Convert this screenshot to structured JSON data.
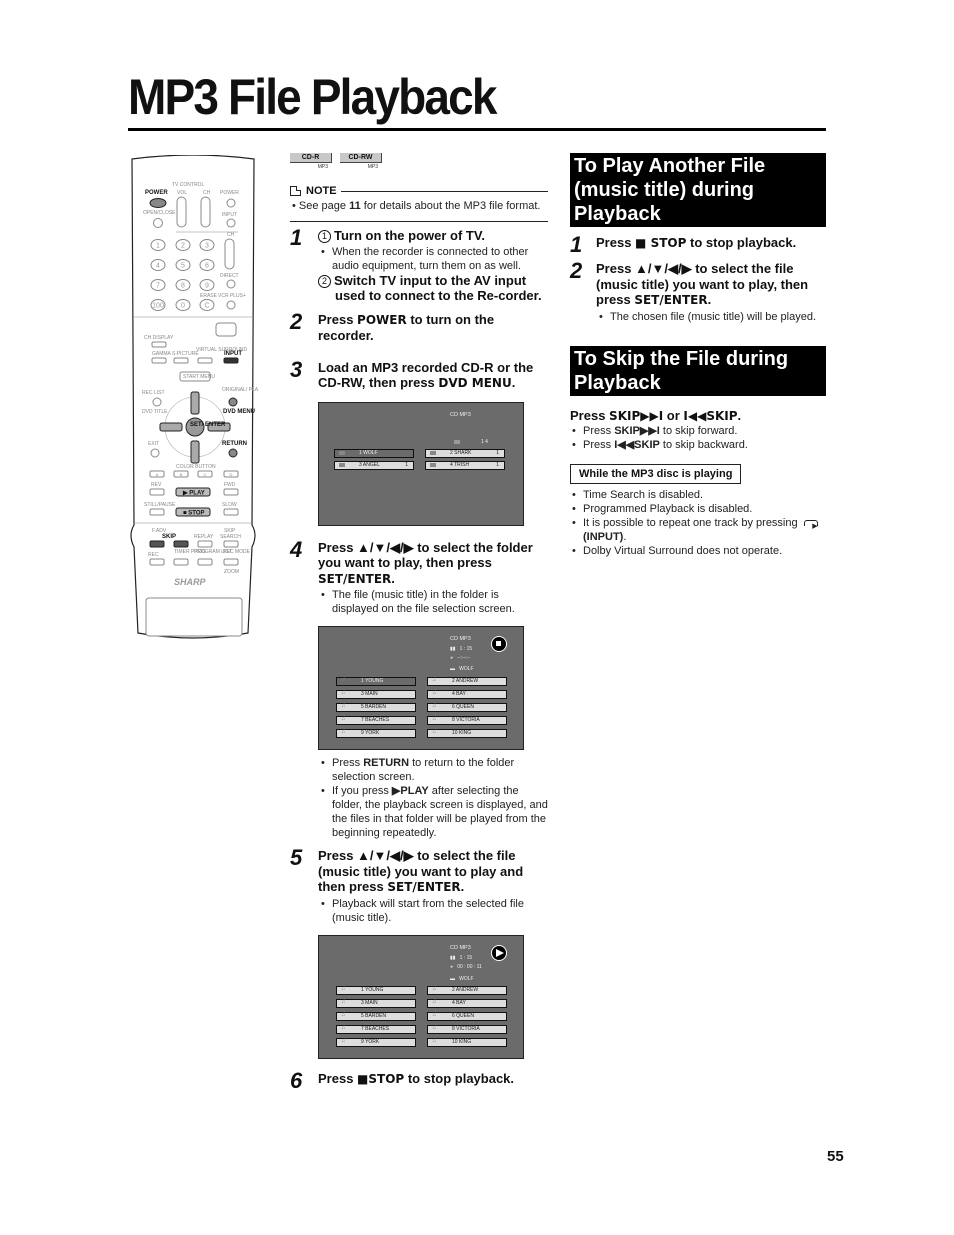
{
  "page": {
    "title": "MP3 File Playback",
    "page_number": "55"
  },
  "remote": {
    "brand": "SHARP",
    "labels": {
      "tv_control": "TV CONTROL",
      "power": "POWER",
      "vol": "VOL",
      "ch": "CH",
      "tv_power": "POWER",
      "open_close": "OPEN/CLOSE",
      "input": "INPUT",
      "ch2": "CH",
      "direct": "DIRECT",
      "erase": "ERASE",
      "vcr_plus": "VCR PLUS+",
      "ch_display": "CH DISPLAY",
      "gamma": "GAMMA",
      "s_picture": "S.PICTURE",
      "virtual_surround": "VIRTUAL SURROUND",
      "input2": "INPUT",
      "start_menu": "START MENU",
      "rec_list": "REC LIST",
      "original_play_list": "ORIGINAL/ PLAY LIST",
      "dvd_title": "DVD TITLE",
      "dvd_menu": "DVD MENU",
      "set_enter": "SET/ ENTER",
      "exit": "EXIT",
      "return": "RETURN",
      "color_button": "COLOR BUTTON",
      "rev": "REV",
      "fwd": "FWD",
      "play": "PLAY",
      "still_pause": "STILL/PAUSE",
      "slow": "SLOW",
      "stop": "STOP",
      "f_adv": "F.ADV",
      "skip": "SKIP",
      "replay": "REPLAY",
      "skip_search": "SKIP SEARCH",
      "rec": "REC",
      "timer_prog": "TIMER PROG.",
      "program_list": "PROGRAM LIST",
      "rec_mode": "REC MODE",
      "zoom": "ZOOM"
    },
    "digits": [
      "1",
      "2",
      "3",
      "4",
      "5",
      "6",
      "7",
      "8",
      "9",
      "100",
      "0",
      "C"
    ],
    "color_buttons": [
      "A",
      "B",
      "C",
      "D"
    ]
  },
  "discs": [
    {
      "label": "CD-R",
      "sub": "MP3"
    },
    {
      "label": "CD-RW",
      "sub": "MP3"
    }
  ],
  "note": {
    "title": "NOTE",
    "text_pre": "See page ",
    "text_bold": "11",
    "text_post": " for details about the MP3 file format."
  },
  "steps": [
    {
      "num": "1",
      "sub1_marker": "1",
      "sub1": "Turn on the power of TV.",
      "sub1_bullet": "When the recorder is connected to other audio equipment, turn them on as well.",
      "sub2_marker": "2",
      "sub2": "Switch TV input to the AV input used to connect to the Re-corder."
    },
    {
      "num": "2",
      "pre": "Press ",
      "key": "POWER",
      "post": " to turn on the recorder."
    },
    {
      "num": "3",
      "pre": "Load an MP3 recorded CD-R or the CD-RW, then press ",
      "key": "DVD MENU",
      "post": "."
    },
    {
      "num": "4",
      "pre": "Press ▲/▼/◀/▶ to select the folder you want to play, then press ",
      "key": "SET/ENTER",
      "post": ".",
      "bullet": "The file (music title) in the folder is displayed on the file selection screen.",
      "after_bullets": [
        {
          "pre": "Press ",
          "key": "RETURN",
          "post": " to return to the folder selection screen."
        },
        {
          "pre": "If you press ",
          "key": "▶PLAY",
          "post": " after selecting the folder, the playback screen is displayed, and the files in that folder will be played from the beginning repeatedly."
        }
      ]
    },
    {
      "num": "5",
      "pre": "Press ▲/▼/◀/▶ to select the file (music title) you want to play and then press ",
      "key": "SET/ENTER",
      "post": ".",
      "bullet": "Playback will start from the selected file (music title)."
    },
    {
      "num": "6",
      "pre": "Press ",
      "key": "■STOP",
      "post": " to stop playback."
    }
  ],
  "osd_folders": {
    "header": "CD MP3",
    "page_info": "1   4",
    "folders": [
      {
        "label": "1  WOLF",
        "count": "",
        "selected": true
      },
      {
        "label": "2  SHARK",
        "count": "1",
        "selected": false
      },
      {
        "label": "3  ANGEL",
        "count": "1",
        "selected": false
      },
      {
        "label": "4  TRISH",
        "count": "1",
        "selected": false
      }
    ]
  },
  "osd_files_stop": {
    "header": "CD MP3",
    "track_time": "1 : 15",
    "elapsed": "--:--:--",
    "folder": "WOLF",
    "status": "stop",
    "files": [
      {
        "label": "1  YOUNG",
        "selected": true
      },
      {
        "label": "2  ANDREW",
        "selected": false
      },
      {
        "label": "3  MAIN",
        "selected": false
      },
      {
        "label": "4  BAY",
        "selected": false
      },
      {
        "label": "5  BARDEN",
        "selected": false
      },
      {
        "label": "6  QUEEN",
        "selected": false
      },
      {
        "label": "7  BEACHES",
        "selected": false
      },
      {
        "label": "8  VICTORIA",
        "selected": false
      },
      {
        "label": "9  YORK",
        "selected": false
      },
      {
        "label": "10  KING",
        "selected": false
      }
    ]
  },
  "osd_files_play": {
    "header": "CD MP3",
    "track_time": "1 :  15",
    "elapsed": "00 : 00 : 11",
    "folder": "WOLF",
    "status": "play",
    "files": [
      {
        "label": "1  YOUNG",
        "selected": false
      },
      {
        "label": "2  ANDREW",
        "selected": false
      },
      {
        "label": "3  MAIN",
        "selected": false
      },
      {
        "label": "4  BAY",
        "selected": false
      },
      {
        "label": "5  BARDEN",
        "selected": false
      },
      {
        "label": "6  QUEEN",
        "selected": false
      },
      {
        "label": "7  BEACHES",
        "selected": false
      },
      {
        "label": "8  VICTORIA",
        "selected": false
      },
      {
        "label": "9  YORK",
        "selected": false
      },
      {
        "label": "10  KING",
        "selected": false
      }
    ]
  },
  "section_play_another": {
    "heading": "To Play Another File (music title) during Playback",
    "steps": [
      {
        "num": "1",
        "pre": "Press ",
        "key": "■ STOP",
        "post": " to stop playback."
      },
      {
        "num": "2",
        "pre": "Press ▲/▼/◀/▶ to select the file (music title) you want to play, then press ",
        "key": "SET/ENTER",
        "post": ".",
        "bullet": "The chosen file (music title) will be played."
      }
    ]
  },
  "section_skip": {
    "heading": "To Skip the File during Playback",
    "press_pre": "Press ",
    "press_key1": "SKIP▶▶I",
    "press_mid": " or ",
    "press_key2": "I◀◀SKIP",
    "press_post": ".",
    "bullets": [
      {
        "pre": "Press ",
        "key": "SKIP▶▶I",
        "post": " to skip forward."
      },
      {
        "pre": "Press ",
        "key": "I◀◀SKIP",
        "post": " to skip backward."
      }
    ]
  },
  "while_playing": {
    "label": "While the MP3 disc is playing",
    "bullets": [
      "Time Search is disabled.",
      "Programmed Playback is disabled."
    ],
    "repeat_pre": "It is possible to repeat one track by pressing ",
    "repeat_key": "(INPUT)",
    "repeat_post": ".",
    "last": "Dolby Virtual Surround does not operate."
  }
}
